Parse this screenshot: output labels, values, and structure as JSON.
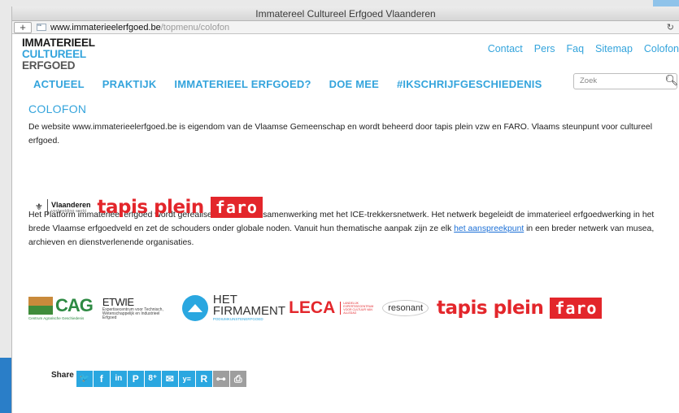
{
  "browser": {
    "title": "Immatereel Cultureel Erfgoed Vlaanderen",
    "url_host": "www.immaterieelerfgoed.be",
    "url_path": "/topmenu/colofon",
    "new_tab_label": "+",
    "reload_icon": "↻"
  },
  "logo": {
    "line1": "IMMATERIEEL",
    "line2": "CULTUREEL",
    "line3": "ERFGOED"
  },
  "topnav": [
    "Contact",
    "Pers",
    "Faq",
    "Sitemap",
    "Colofon"
  ],
  "mainnav": [
    "ACTUEEL",
    "PRAKTIJK",
    "IMMATERIEEL ERFGOED?",
    "DOE MEE",
    "#IKSCHRIJFGESCHIEDENIS"
  ],
  "search": {
    "placeholder": "Zoek",
    "icon": "search-icon"
  },
  "content": {
    "heading": "COLOFON",
    "para1": "De website www.immaterieelerfgoed.be is eigendom van de Vlaamse Gemeenschap en wordt beheerd door tapis plein vzw en FARO. Vlaams steunpunt voor cultureel erfgoed.",
    "para2_before": "Het Platform immaterieel erfgoed wordt gerealiseerd in nauwe samenwerking met het ICE-trekkersnetwerk. Het netwerk begeleidt de immaterieel erfgoedwerking in het brede Vlaamse erfgoedveld en zet de schouders onder globale noden. Vanuit hun thematische aanpak zijn ze elk ",
    "para2_link": "het aanspreekpunt",
    "para2_after": " in een breder netwerk van musea, archieven en dienstverlenende organisaties."
  },
  "logos_owners": {
    "vlaanderen": "Vlaanderen",
    "vlaanderen_sub": "verbeelding werkt",
    "tapis": "tapis plein",
    "faro": "faro"
  },
  "partners": {
    "cag": "CAG",
    "cag_sub": "Centrum Agrarische Geschiedenis",
    "etwie": "ETWIE",
    "etwie_sub": "Expertisecentrum voor Technisch, Wetenschappelijk en Industrieel Erfgoed",
    "firmament1": "HET",
    "firmament2": "FIRMAMENT",
    "firmament_sub": "PODIUMKUNSTENERFGOED",
    "leca": "LECA",
    "leca_sub": "LANDELIJK EXPERTISECENTRUM VOOR CULTUUR VAN ALLEDAG",
    "resonant": "resonant",
    "tapis": "tapis plein",
    "faro": "faro"
  },
  "share": {
    "label": "Share",
    "buttons": [
      "twitter-icon",
      "facebook-icon",
      "linkedin-icon",
      "pinterest-icon",
      "googleplus-icon",
      "email-icon",
      "yammer-icon",
      "r-icon",
      "link-icon",
      "print-icon"
    ],
    "glyphs": [
      "🐦",
      "f",
      "in",
      "P",
      "8⁺",
      "✉",
      "y≡",
      "R",
      "⊶",
      "⎙"
    ]
  }
}
